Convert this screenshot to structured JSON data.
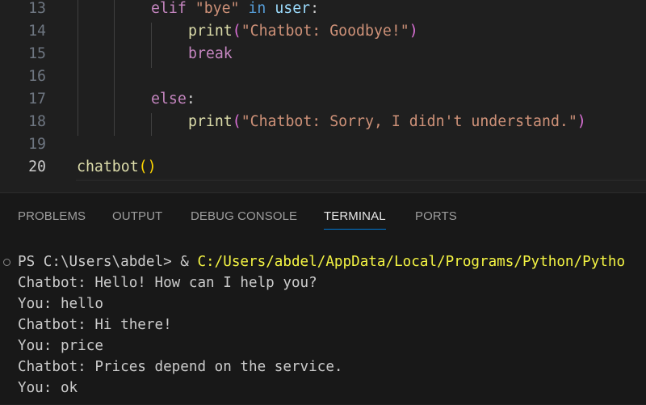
{
  "editor": {
    "lines": [
      {
        "num": "13",
        "tokens": [
          {
            "t": "elif ",
            "c": "k"
          },
          {
            "t": "\"bye\"",
            "c": "s"
          },
          {
            "t": " ",
            "c": ""
          },
          {
            "t": "in",
            "c": "b"
          },
          {
            "t": " ",
            "c": ""
          },
          {
            "t": "user",
            "c": "v"
          },
          {
            "t": ":",
            "c": ""
          }
        ]
      },
      {
        "num": "14",
        "tokens": [
          {
            "t": "print",
            "c": "f"
          },
          {
            "t": "(",
            "c": "p2"
          },
          {
            "t": "\"Chatbot: Goodbye!\"",
            "c": "s"
          },
          {
            "t": ")",
            "c": "p2"
          }
        ]
      },
      {
        "num": "15",
        "tokens": [
          {
            "t": "break",
            "c": "k"
          }
        ]
      },
      {
        "num": "16",
        "tokens": []
      },
      {
        "num": "17",
        "tokens": [
          {
            "t": "else",
            "c": "k"
          },
          {
            "t": ":",
            "c": ""
          }
        ]
      },
      {
        "num": "18",
        "tokens": [
          {
            "t": "print",
            "c": "f"
          },
          {
            "t": "(",
            "c": "p2"
          },
          {
            "t": "\"Chatbot: Sorry, I didn't understand.\"",
            "c": "s"
          },
          {
            "t": ")",
            "c": "p2"
          }
        ]
      },
      {
        "num": "19",
        "tokens": []
      },
      {
        "num": "20",
        "tokens": [
          {
            "t": "chatbot",
            "c": "f"
          },
          {
            "t": "()",
            "c": "p1"
          }
        ]
      }
    ]
  },
  "panel": {
    "tabs": [
      {
        "label": "PROBLEMS"
      },
      {
        "label": "OUTPUT"
      },
      {
        "label": "DEBUG CONSOLE"
      },
      {
        "label": "TERMINAL"
      },
      {
        "label": "PORTS"
      }
    ],
    "active_tab": "TERMINAL"
  },
  "terminal": {
    "prompt": "PS C:\\Users\\abdel> ",
    "command_amp": "& ",
    "command_path": "C:/Users/abdel/AppData/Local/Programs/Python/Pytho",
    "output": [
      "Chatbot: Hello! How can I help you?",
      "You: hello",
      "Chatbot: Hi there!",
      "You: price",
      "Chatbot: Prices depend on the service.",
      "You: ok"
    ]
  },
  "colors": {
    "background": "#1f1f1f",
    "panel_background": "#181818",
    "active_tab_underline": "#0078d4",
    "keyword": "#c586c0",
    "string": "#ce9178",
    "function": "#dcdcaa",
    "path_yellow": "#f5f543"
  }
}
